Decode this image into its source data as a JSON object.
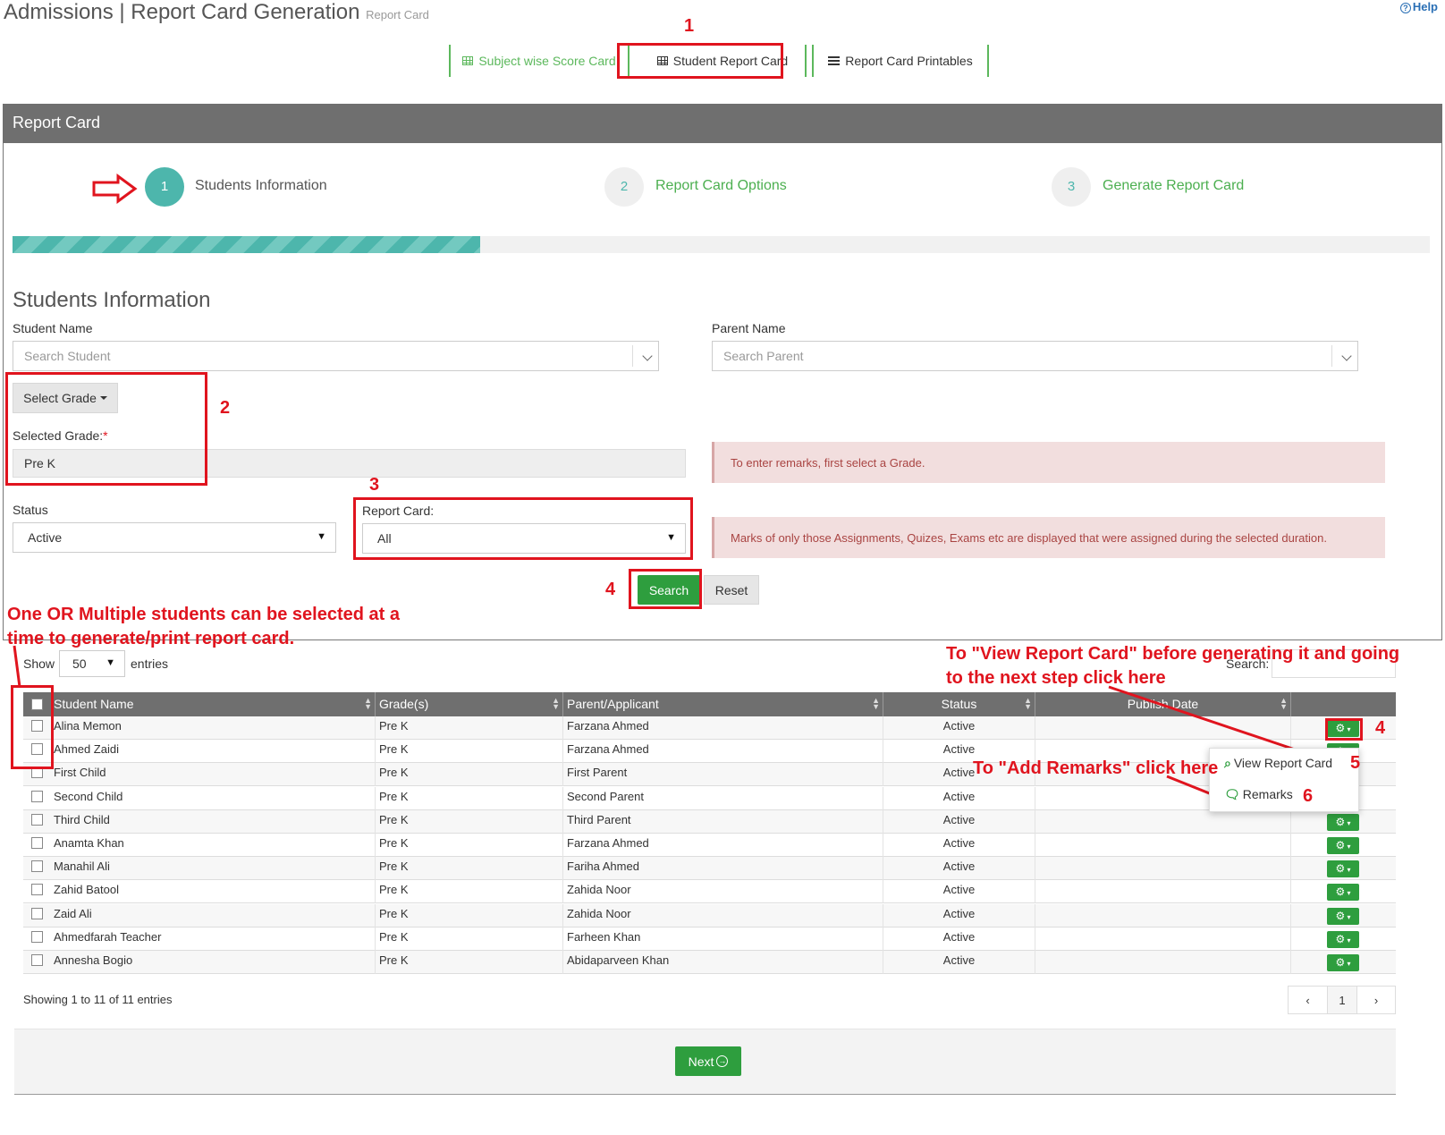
{
  "header": {
    "title": "Admissions | Report Card Generation",
    "subtitle": "Report Card",
    "help": "Help"
  },
  "tabs": [
    {
      "label": "Subject wise Score Card"
    },
    {
      "label": "Student Report Card"
    },
    {
      "label": "Report Card Printables"
    }
  ],
  "panel": {
    "title": "Report Card",
    "progress_percent": 33
  },
  "steps": [
    {
      "number": "1",
      "label": "Students Information"
    },
    {
      "number": "2",
      "label": "Report Card Options"
    },
    {
      "number": "3",
      "label": "Generate Report Card"
    }
  ],
  "form": {
    "section_title": "Students Information",
    "student_name_label": "Student Name",
    "student_name_placeholder": "Search Student",
    "parent_name_label": "Parent Name",
    "parent_name_placeholder": "Search Parent",
    "select_grade_button": "Select Grade",
    "selected_grade_label": "Selected Grade:",
    "required_mark": "*",
    "selected_grade_value": "Pre K",
    "status_label": "Status",
    "status_value": "Active",
    "report_card_label": "Report Card:",
    "report_card_value": "All",
    "alert_remarks": "To enter remarks, first select a Grade.",
    "alert_marks": "Marks of only those Assignments, Quizes, Exams etc are displayed that were assigned during the selected duration.",
    "search_button": "Search",
    "reset_button": "Reset"
  },
  "table_controls": {
    "show_label": "Show",
    "entries_value": "50",
    "entries_label": "entries",
    "search_label": "Search:"
  },
  "table": {
    "columns": [
      "Student Name",
      "Grade(s)",
      "Parent/Applicant",
      "Status",
      "Publish Date"
    ],
    "rows": [
      {
        "student": "Alina Memon",
        "grade": "Pre K",
        "parent": "Farzana Ahmed",
        "status": "Active"
      },
      {
        "student": "Ahmed Zaidi",
        "grade": "Pre K",
        "parent": "Farzana Ahmed",
        "status": "Active"
      },
      {
        "student": "First Child",
        "grade": "Pre K",
        "parent": "First Parent",
        "status": "Active"
      },
      {
        "student": "Second Child",
        "grade": "Pre K",
        "parent": "Second Parent",
        "status": "Active"
      },
      {
        "student": "Third Child",
        "grade": "Pre K",
        "parent": "Third Parent",
        "status": "Active"
      },
      {
        "student": "Anamta Khan",
        "grade": "Pre K",
        "parent": "Farzana Ahmed",
        "status": "Active"
      },
      {
        "student": "Manahil Ali",
        "grade": "Pre K",
        "parent": "Fariha Ahmed",
        "status": "Active"
      },
      {
        "student": "Zahid Batool",
        "grade": "Pre K",
        "parent": "Zahida Noor",
        "status": "Active"
      },
      {
        "student": "Zaid Ali",
        "grade": "Pre K",
        "parent": "Zahida Noor",
        "status": "Active"
      },
      {
        "student": "Ahmedfarah Teacher",
        "grade": "Pre K",
        "parent": "Farheen Khan",
        "status": "Active"
      },
      {
        "student": "Annesha Bogio",
        "grade": "Pre K",
        "parent": "Abidaparveen Khan",
        "status": "Active"
      }
    ],
    "summary": "Showing 1 to 11 of 11 entries",
    "page": "1"
  },
  "row_menu": {
    "view_report_card": "View Report Card",
    "remarks": "Remarks"
  },
  "next_button": "Next",
  "annotations": {
    "n1": "1",
    "n2": "2",
    "n3": "3",
    "n4a": "4",
    "n4b": "4",
    "n5": "5",
    "n6": "6",
    "multi_select_line1": "One OR Multiple students can be selected at a",
    "multi_select_line2": "time to generate/print report card.",
    "view_hint_line1": "To \"View Report Card\" before generating it and going",
    "view_hint_line2": "to the next step click here",
    "remarks_hint": "To \"Add Remarks\" click here"
  },
  "colors": {
    "accent_teal": "#4db6ac",
    "green": "#2e9e3e",
    "annotation_red": "#e0141e",
    "header_grey": "#6f6f6f"
  }
}
